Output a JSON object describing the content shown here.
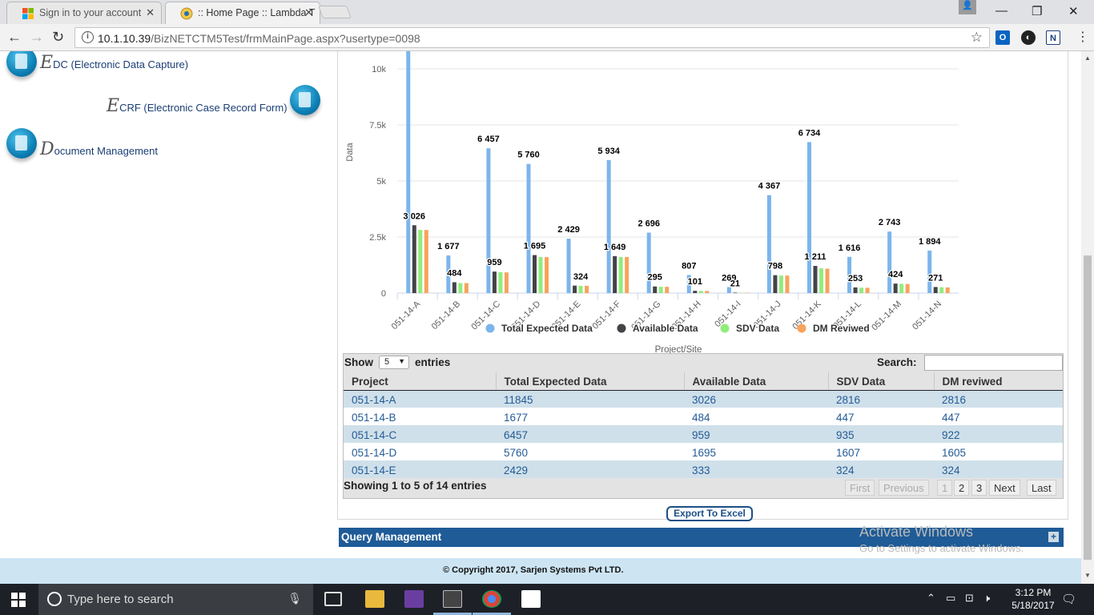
{
  "browser": {
    "tabs": [
      {
        "title": "Sign in to your account",
        "active": false
      },
      {
        "title": ":: Home Page :: Lambda T",
        "active": true
      }
    ],
    "url_host": "10.1.10.39",
    "url_path": "/BizNETCTM5Test/frmMainPage.aspx?usertype=0098"
  },
  "sidebar": {
    "items": [
      {
        "cap": "E",
        "label": "DC (Electronic Data Capture)"
      },
      {
        "cap": "E",
        "label": "CRF (Electronic Case Record Form)"
      },
      {
        "cap": "D",
        "label": "ocument Management"
      }
    ]
  },
  "chart_data": {
    "type": "bar",
    "title": "",
    "xlabel": "Project/Site",
    "ylabel": "Data",
    "ylim": [
      0,
      10000
    ],
    "yticks": [
      "0",
      "2.5k",
      "5k",
      "7.5k",
      "10k"
    ],
    "categories": [
      "051-14-A",
      "051-14-B",
      "051-14-C",
      "051-14-D",
      "051-14-E",
      "051-14-F",
      "051-14-G",
      "051-14-H",
      "051-14-I",
      "051-14-J",
      "051-14-K",
      "051-14-L",
      "051-14-M",
      "051-14-N"
    ],
    "series": [
      {
        "name": "Total Expected Data",
        "color": "#7cb5ec",
        "values": [
          11845,
          1677,
          6457,
          5760,
          2429,
          5934,
          2696,
          807,
          269,
          4367,
          6734,
          1616,
          2743,
          1894
        ]
      },
      {
        "name": "Available Data",
        "color": "#434348",
        "values": [
          3026,
          484,
          959,
          1695,
          333,
          1649,
          295,
          101,
          21,
          798,
          1211,
          253,
          424,
          271
        ]
      },
      {
        "name": "SDV Data",
        "color": "#90ed7d",
        "values": [
          2816,
          447,
          935,
          1607,
          324,
          1611,
          280,
          95,
          18,
          780,
          1100,
          240,
          410,
          260
        ]
      },
      {
        "name": "DM Reviwed",
        "color": "#f7a35c",
        "values": [
          2816,
          447,
          922,
          1605,
          324,
          1611,
          280,
          95,
          18,
          780,
          1090,
          238,
          405,
          255
        ]
      }
    ],
    "data_labels": [
      {
        "cat": 0,
        "series": 1,
        "text": "3 026"
      },
      {
        "cat": 1,
        "series": 0,
        "text": "1 677"
      },
      {
        "cat": 1,
        "series": 1,
        "text": "484"
      },
      {
        "cat": 2,
        "series": 0,
        "text": "6 457"
      },
      {
        "cat": 2,
        "series": 1,
        "text": "959"
      },
      {
        "cat": 3,
        "series": 0,
        "text": "5 760"
      },
      {
        "cat": 3,
        "series": 1,
        "text": "1 695"
      },
      {
        "cat": 4,
        "series": 0,
        "text": "2 429"
      },
      {
        "cat": 4,
        "series": 2,
        "text": "324"
      },
      {
        "cat": 5,
        "series": 0,
        "text": "5 934"
      },
      {
        "cat": 5,
        "series": 1,
        "text": "1 649"
      },
      {
        "cat": 6,
        "series": 0,
        "text": "2 696"
      },
      {
        "cat": 6,
        "series": 1,
        "text": "295"
      },
      {
        "cat": 7,
        "series": 0,
        "text": "807"
      },
      {
        "cat": 7,
        "series": 1,
        "text": "101"
      },
      {
        "cat": 8,
        "series": 0,
        "text": "269"
      },
      {
        "cat": 8,
        "series": 1,
        "text": "21"
      },
      {
        "cat": 9,
        "series": 0,
        "text": "4 367"
      },
      {
        "cat": 9,
        "series": 1,
        "text": "798"
      },
      {
        "cat": 10,
        "series": 0,
        "text": "6 734"
      },
      {
        "cat": 10,
        "series": 1,
        "text": "1 211"
      },
      {
        "cat": 11,
        "series": 0,
        "text": "1 616"
      },
      {
        "cat": 11,
        "series": 1,
        "text": "253"
      },
      {
        "cat": 12,
        "series": 0,
        "text": "2 743"
      },
      {
        "cat": 12,
        "series": 1,
        "text": "424"
      },
      {
        "cat": 13,
        "series": 0,
        "text": "1 894"
      },
      {
        "cat": 13,
        "series": 1,
        "text": "271"
      }
    ],
    "legend_position": "bottom-center",
    "grid": true
  },
  "table": {
    "show_label": "Show",
    "length_value": "5",
    "entries_label": "entries",
    "search_label": "Search:",
    "columns": [
      "Project",
      "Total Expected Data",
      "Available Data",
      "SDV Data",
      "DM reviwed"
    ],
    "rows": [
      [
        "051-14-A",
        "11845",
        "3026",
        "2816",
        "2816"
      ],
      [
        "051-14-B",
        "1677",
        "484",
        "447",
        "447"
      ],
      [
        "051-14-C",
        "6457",
        "959",
        "935",
        "922"
      ],
      [
        "051-14-D",
        "5760",
        "1695",
        "1607",
        "1605"
      ],
      [
        "051-14-E",
        "2429",
        "333",
        "324",
        "324"
      ]
    ],
    "info": "Showing 1 to 5 of 14 entries",
    "pager": {
      "first": "First",
      "previous": "Previous",
      "pages": [
        "1",
        "2",
        "3"
      ],
      "next": "Next",
      "last": "Last"
    }
  },
  "export_label": "Export To Excel",
  "query_management": "Query Management",
  "plus_glyph": "+",
  "watermark": {
    "line1": "Activate Windows",
    "line2": "Go to Settings to activate Windows."
  },
  "footer": "© Copyright 2017, Sarjen Systems Pvt LTD.",
  "taskbar": {
    "search_placeholder": "Type here to search",
    "time": "3:12 PM",
    "date": "5/18/2017"
  }
}
